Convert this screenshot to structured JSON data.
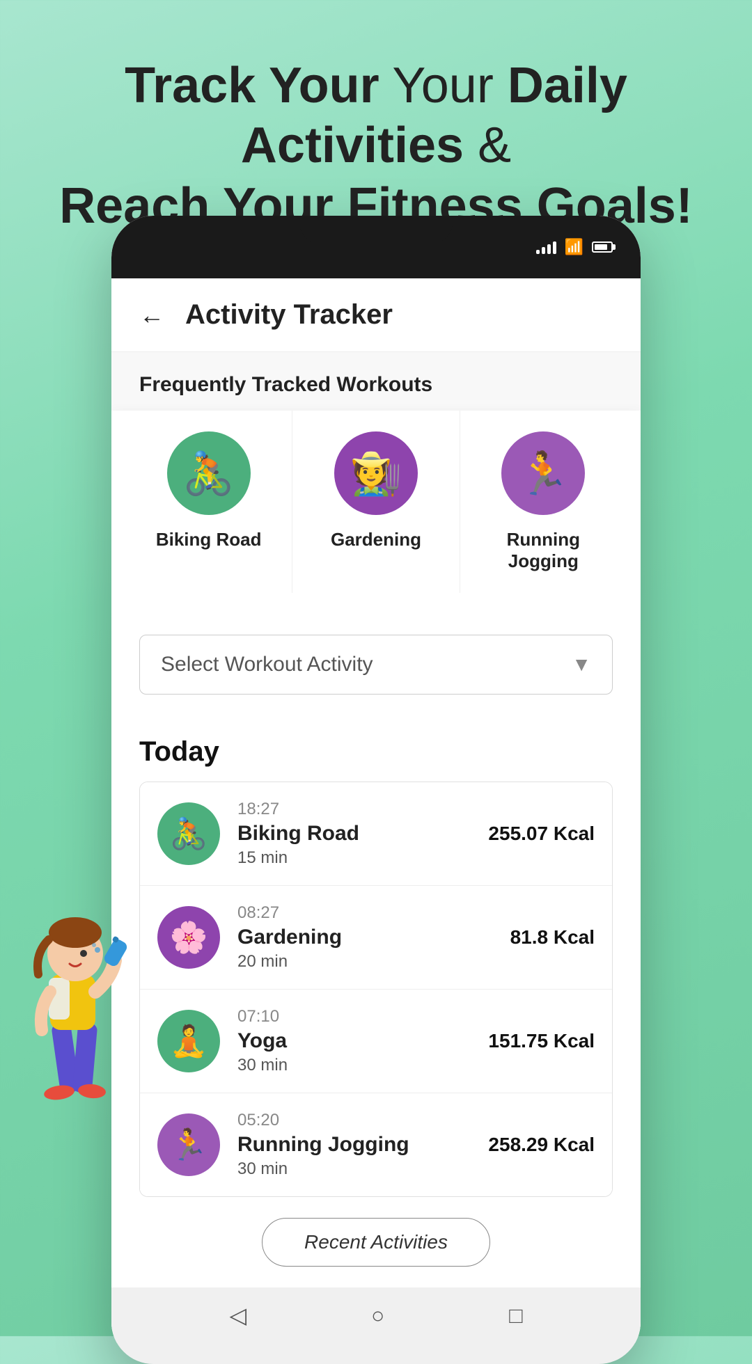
{
  "hero": {
    "line1_regular": "Track Your",
    "line1_bold": "Daily Activities",
    "line1_suffix": " &",
    "line2": "Reach Your Fitness Goals!"
  },
  "app": {
    "title": "Activity Tracker",
    "back_label": "←"
  },
  "frequent_section": {
    "label": "Frequently Tracked Workouts"
  },
  "workout_cards": [
    {
      "name": "Biking Road",
      "icon": "🚴",
      "color": "#4caf7d"
    },
    {
      "name": "Gardening",
      "icon": "🧑‍🌾",
      "color": "#8e44ad"
    },
    {
      "name": "Running Jogging",
      "icon": "🏃",
      "color": "#9b59b6"
    }
  ],
  "dropdown": {
    "placeholder": "Select Workout Activity",
    "arrow": "▼"
  },
  "today": {
    "title": "Today",
    "activities": [
      {
        "time": "18:27",
        "name": "Biking Road",
        "duration": "15 min",
        "kcal": "255.07 Kcal",
        "icon": "🚴",
        "color": "#4caf7d"
      },
      {
        "time": "08:27",
        "name": "Gardening",
        "duration": "20 min",
        "kcal": "81.8 Kcal",
        "icon": "🌸",
        "color": "#8e44ad"
      },
      {
        "time": "07:10",
        "name": "Yoga",
        "duration": "30 min",
        "kcal": "151.75 Kcal",
        "icon": "🧘",
        "color": "#4caf7d"
      },
      {
        "time": "05:20",
        "name": "Running Jogging",
        "duration": "30 min",
        "kcal": "258.29 Kcal",
        "icon": "🏃",
        "color": "#9b59b6"
      }
    ]
  },
  "recent_btn": {
    "label": "Recent Activities"
  },
  "bottom_nav": {
    "back": "◁",
    "home": "○",
    "square": "□"
  }
}
